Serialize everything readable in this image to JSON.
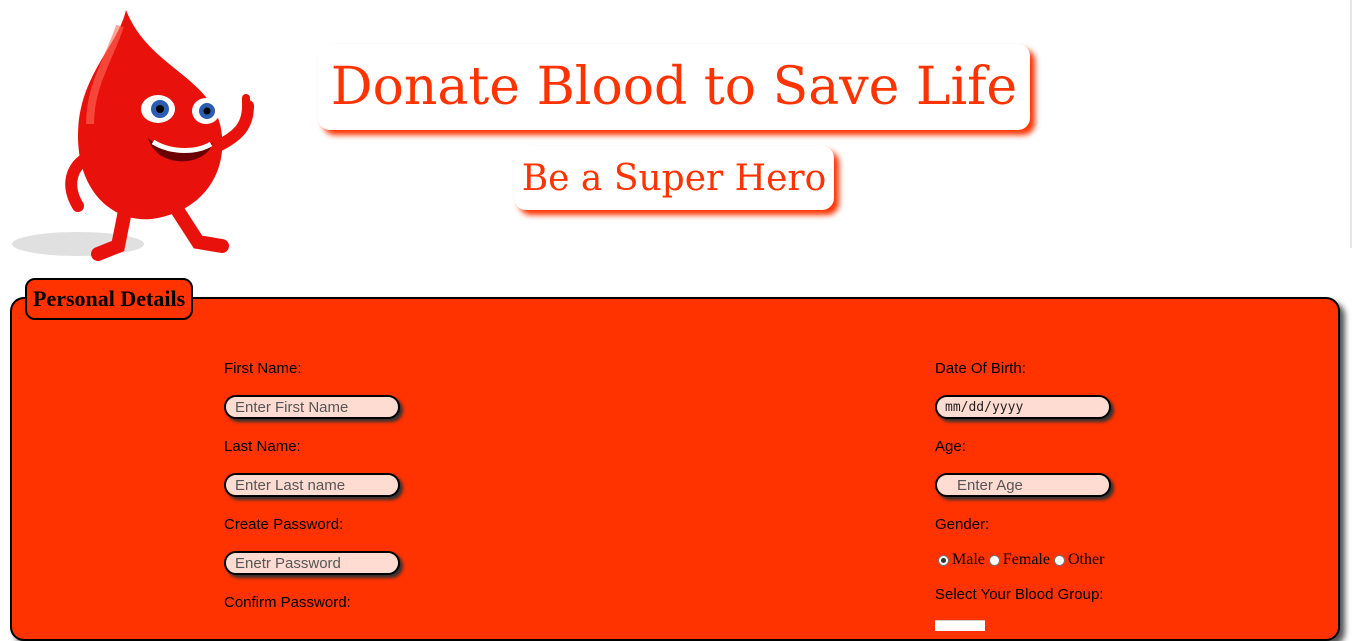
{
  "header": {
    "title": "Donate Blood to Save Life",
    "subtitle": "Be a Super Hero"
  },
  "form": {
    "legend": "Personal Details",
    "first_name": {
      "label": "First Name:",
      "placeholder": "Enter First Name"
    },
    "last_name": {
      "label": "Last Name:",
      "placeholder": "Enter Last name"
    },
    "create_password": {
      "label": "Create Password:",
      "placeholder": "Enetr Password"
    },
    "confirm_password": {
      "label": "Confirm Password:"
    },
    "dob": {
      "label": "Date Of Birth:",
      "value": "mm/dd/yyyy"
    },
    "age": {
      "label": "Age:",
      "placeholder": "Enter Age"
    },
    "gender": {
      "label": "Gender:",
      "options": [
        "Male",
        "Female",
        "Other"
      ],
      "selected": "Male"
    },
    "blood_group": {
      "label": "Select Your Blood Group:"
    }
  },
  "colors": {
    "accent": "#ff3300",
    "input_bg": "#ffdcd2",
    "border": "#000000"
  },
  "icons": {
    "mascot": "blood-drop-mascot-icon"
  }
}
